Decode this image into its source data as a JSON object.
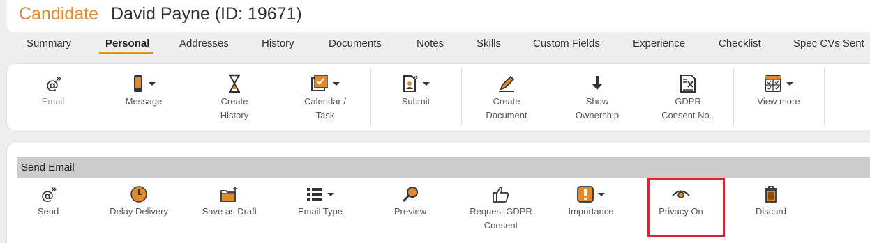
{
  "header": {
    "entity": "Candidate",
    "title": "David Payne (ID: 19671)"
  },
  "tabs": [
    {
      "label": "Summary"
    },
    {
      "label": "Personal",
      "active": true
    },
    {
      "label": "Addresses"
    },
    {
      "label": "History"
    },
    {
      "label": "Documents"
    },
    {
      "label": "Notes"
    },
    {
      "label": "Skills"
    },
    {
      "label": "Custom Fields"
    },
    {
      "label": "Experience"
    },
    {
      "label": "Checklist"
    },
    {
      "label": "Spec CVs Sent"
    }
  ],
  "toolbar": {
    "email": "Email",
    "message": "Message",
    "create_history_1": "Create",
    "create_history_2": "History",
    "calendar_1": "Calendar /",
    "calendar_2": "Task",
    "submit": "Submit",
    "create_doc_1": "Create",
    "create_doc_2": "Document",
    "show_owner_1": "Show",
    "show_owner_2": "Ownership",
    "gdpr_1": "GDPR",
    "gdpr_2": "Consent No..",
    "view_more": "View more"
  },
  "email_panel": {
    "title": "Send Email",
    "send": "Send",
    "delay": "Delay Delivery",
    "draft": "Save as Draft",
    "email_type": "Email Type",
    "preview": "Preview",
    "gdpr_1": "Request GDPR",
    "gdpr_2": "Consent",
    "importance": "Importance",
    "privacy": "Privacy On",
    "discard": "Discard"
  },
  "colors": {
    "accent": "#e08a2e",
    "highlight": "#d9252e",
    "bar": "#cccccc"
  }
}
